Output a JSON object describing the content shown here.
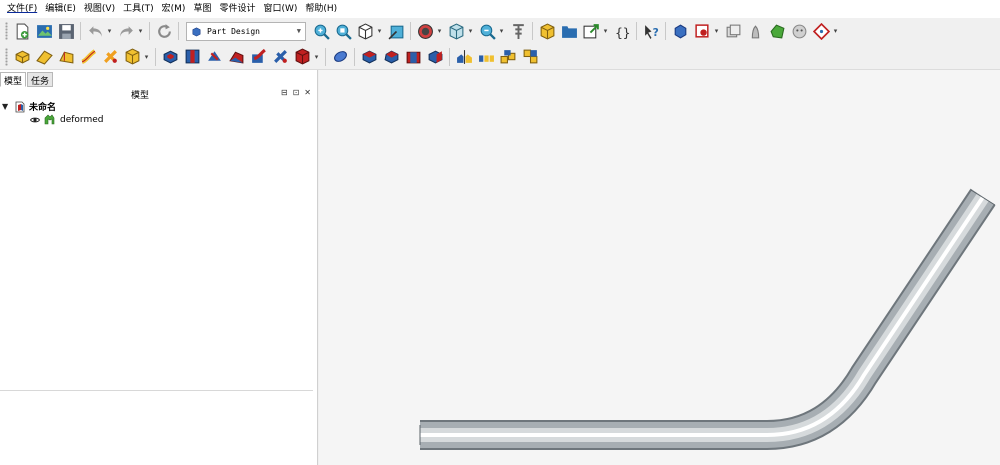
{
  "menubar": {
    "items": [
      "文件(F)",
      "编辑(E)",
      "视图(V)",
      "工具(T)",
      "宏(M)",
      "草图",
      "零件设计",
      "窗口(W)",
      "帮助(H)"
    ]
  },
  "toolbar1": {
    "workbench_selector": "Part Design"
  },
  "left_panel": {
    "tabs": [
      "模型",
      "任务"
    ],
    "title": "模型",
    "controls": [
      "⊟",
      "⊡",
      "✕"
    ],
    "tree": {
      "root": {
        "toggle": "▼",
        "label": "未命名"
      },
      "children": [
        {
          "label": "deformed"
        }
      ]
    }
  },
  "colors": {
    "menubar_bg": "#ffffff",
    "toolbar_bg": "#f0f0f0",
    "viewport_bg": "#f5f5f5",
    "pipe_gray": "#8c949a",
    "pipe_highlight": "#ffffff",
    "active_menu_underline": "#0a2a9a"
  }
}
